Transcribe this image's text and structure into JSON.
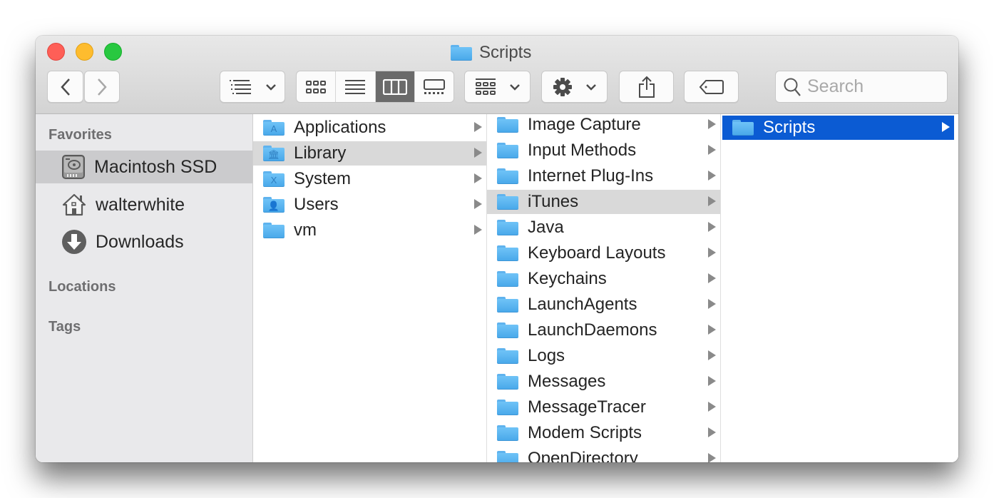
{
  "window": {
    "title": "Scripts",
    "traffic_lights": [
      "close",
      "minimize",
      "zoom"
    ]
  },
  "toolbar": {
    "back_icon": "chevron-left-icon",
    "forward_icon": "chevron-right-icon",
    "group_icon": "group-list-icon",
    "view_modes": [
      {
        "name": "icon-view",
        "active": false
      },
      {
        "name": "list-view",
        "active": false
      },
      {
        "name": "column-view",
        "active": true
      },
      {
        "name": "gallery-view",
        "active": false
      }
    ],
    "arrange_icon": "arrange-grid-icon",
    "action_icon": "gear-icon",
    "share_icon": "share-icon",
    "tag_icon": "tag-icon",
    "search_placeholder": "Search"
  },
  "sidebar": {
    "favorites_heading": "Favorites",
    "favorites": [
      {
        "label": "Macintosh SSD",
        "icon": "hard-drive-icon",
        "selected": true
      },
      {
        "label": "walterwhite",
        "icon": "home-icon",
        "selected": false
      },
      {
        "label": "Downloads",
        "icon": "downloads-icon",
        "selected": false
      }
    ],
    "locations_heading": "Locations",
    "tags_heading": "Tags"
  },
  "columns": [
    {
      "items": [
        {
          "label": "Applications",
          "glyph": "A",
          "state": ""
        },
        {
          "label": "Library",
          "glyph": "🏛",
          "state": "hl"
        },
        {
          "label": "System",
          "glyph": "X",
          "state": ""
        },
        {
          "label": "Users",
          "glyph": "👤",
          "state": ""
        },
        {
          "label": "vm",
          "glyph": "",
          "state": ""
        }
      ]
    },
    {
      "items": [
        {
          "label": "Image Capture",
          "state": ""
        },
        {
          "label": "Input Methods",
          "state": ""
        },
        {
          "label": "Internet Plug-Ins",
          "state": ""
        },
        {
          "label": "iTunes",
          "state": "hl"
        },
        {
          "label": "Java",
          "state": ""
        },
        {
          "label": "Keyboard Layouts",
          "state": ""
        },
        {
          "label": "Keychains",
          "state": ""
        },
        {
          "label": "LaunchAgents",
          "state": ""
        },
        {
          "label": "LaunchDaemons",
          "state": ""
        },
        {
          "label": "Logs",
          "state": ""
        },
        {
          "label": "Messages",
          "state": ""
        },
        {
          "label": "MessageTracer",
          "state": ""
        },
        {
          "label": "Modem Scripts",
          "state": ""
        },
        {
          "label": "OpenDirectory",
          "state": ""
        }
      ]
    },
    {
      "items": [
        {
          "label": "Scripts",
          "state": "sel"
        }
      ]
    }
  ]
}
